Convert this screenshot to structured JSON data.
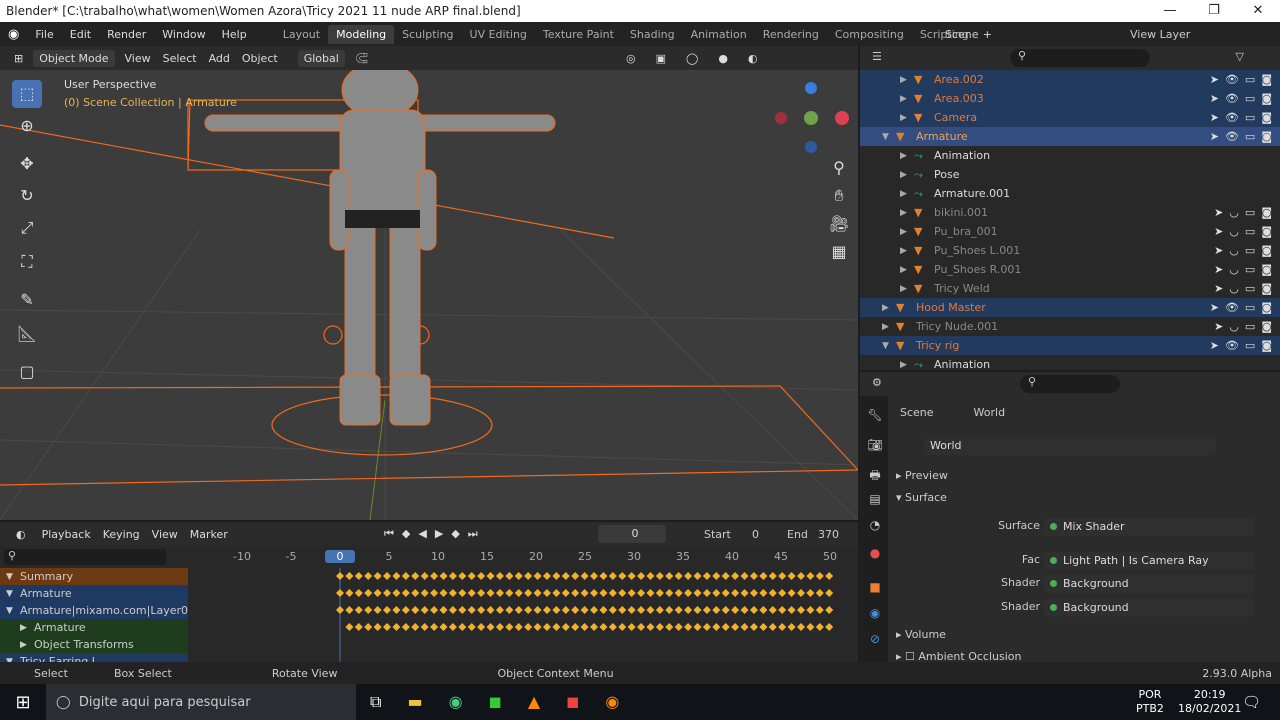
{
  "window": {
    "title": "Blender* [C:\\trabalho\\what\\women\\Women Azora\\Tricy 2021 11 nude ARP final.blend]",
    "min": "—",
    "max": "❐",
    "close": "✕"
  },
  "menus": [
    "File",
    "Edit",
    "Render",
    "Window",
    "Help"
  ],
  "workspaces": [
    "Layout",
    "Modeling",
    "Sculpting",
    "UV Editing",
    "Texture Paint",
    "Shading",
    "Animation",
    "Rendering",
    "Compositing",
    "Scripting"
  ],
  "active_workspace": "Modeling",
  "scene": "Scene",
  "view_layer": "View Layer",
  "viewport": {
    "mode": "Object Mode",
    "menus": [
      "View",
      "Select",
      "Add",
      "Object"
    ],
    "orientation": "Global",
    "perspective": "User Perspective",
    "collection": "(0) Scene Collection | Armature"
  },
  "outliner": {
    "rows": [
      {
        "name": "Area.002",
        "indent": 2,
        "color": "#e07a3a",
        "sel": "sel",
        "vis": true
      },
      {
        "name": "Area.003",
        "indent": 2,
        "color": "#e07a3a",
        "sel": "sel",
        "vis": true
      },
      {
        "name": "Camera",
        "indent": 2,
        "color": "#e07a3a",
        "sel": "sel",
        "vis": true
      },
      {
        "name": "Armature",
        "indent": 1,
        "color": "#f0a050",
        "sel": "act",
        "vis": true,
        "open": true
      },
      {
        "name": "Animation",
        "indent": 2,
        "color": "#ddd",
        "sel": ""
      },
      {
        "name": "Pose",
        "indent": 2,
        "color": "#ddd",
        "sel": ""
      },
      {
        "name": "Armature.001",
        "indent": 2,
        "color": "#ddd",
        "sel": ""
      },
      {
        "name": "bikini.001",
        "indent": 2,
        "color": "#888",
        "sel": "",
        "vis": true,
        "hidden": true
      },
      {
        "name": "Pu_bra_001",
        "indent": 2,
        "color": "#888",
        "sel": "",
        "vis": true,
        "hidden": true
      },
      {
        "name": "Pu_Shoes L.001",
        "indent": 2,
        "color": "#888",
        "sel": "",
        "vis": true,
        "hidden": true
      },
      {
        "name": "Pu_Shoes R.001",
        "indent": 2,
        "color": "#888",
        "sel": "",
        "vis": true,
        "hidden": true
      },
      {
        "name": "Tricy Weld",
        "indent": 2,
        "color": "#888",
        "sel": "",
        "vis": true,
        "hidden": true
      },
      {
        "name": "Hood Master",
        "indent": 1,
        "color": "#e07a3a",
        "sel": "sel",
        "vis": true
      },
      {
        "name": "Tricy Nude.001",
        "indent": 1,
        "color": "#888",
        "sel": "",
        "vis": true,
        "hidden": true
      },
      {
        "name": "Tricy rig",
        "indent": 1,
        "color": "#e07a3a",
        "sel": "sel",
        "vis": true,
        "open": true
      },
      {
        "name": "Animation",
        "indent": 2,
        "color": "#ddd",
        "sel": ""
      }
    ]
  },
  "properties": {
    "breadcrumb": [
      "Scene",
      "World"
    ],
    "world": "World",
    "panels": {
      "preview": "Preview",
      "surface": "Surface",
      "volume": "Volume",
      "ao": "Ambient Occlusion"
    },
    "fields": [
      {
        "label": "Surface",
        "value": "Mix Shader"
      },
      {
        "label": "Fac",
        "value": "Light Path | Is Camera Ray"
      },
      {
        "label": "Shader",
        "value": "Background"
      },
      {
        "label": "Shader",
        "value": "Background"
      }
    ]
  },
  "timeline": {
    "menus": [
      "Playback",
      "Keying",
      "View",
      "Marker"
    ],
    "current_frame": "0",
    "start_label": "Start",
    "start": "0",
    "end_label": "End",
    "end": "370",
    "ticks": [
      "-10",
      "-5",
      "0",
      "5",
      "10",
      "15",
      "20",
      "25",
      "30",
      "35",
      "40",
      "45",
      "50"
    ],
    "channels": [
      {
        "name": "Summary",
        "bg": "#6b3a12"
      },
      {
        "name": "Armature",
        "bg": "#1f3a62"
      },
      {
        "name": "Armature|mixamo.com|Layer0",
        "bg": "#1f3a62"
      },
      {
        "name": "Armature",
        "bg": "#1d3d1d"
      },
      {
        "name": "Object Transforms",
        "bg": "#1d3d1d"
      },
      {
        "name": "Tricy Earring L",
        "bg": "#1f3a62"
      }
    ]
  },
  "status": {
    "select": "Select",
    "box": "Box Select",
    "rotate": "Rotate View",
    "context": "Object Context Menu",
    "version": "2.93.0 Alpha"
  },
  "taskbar": {
    "search": "Digite aqui para pesquisar",
    "lang1": "POR",
    "lang2": "PTB2",
    "time": "20:19",
    "date": "18/02/2021"
  }
}
